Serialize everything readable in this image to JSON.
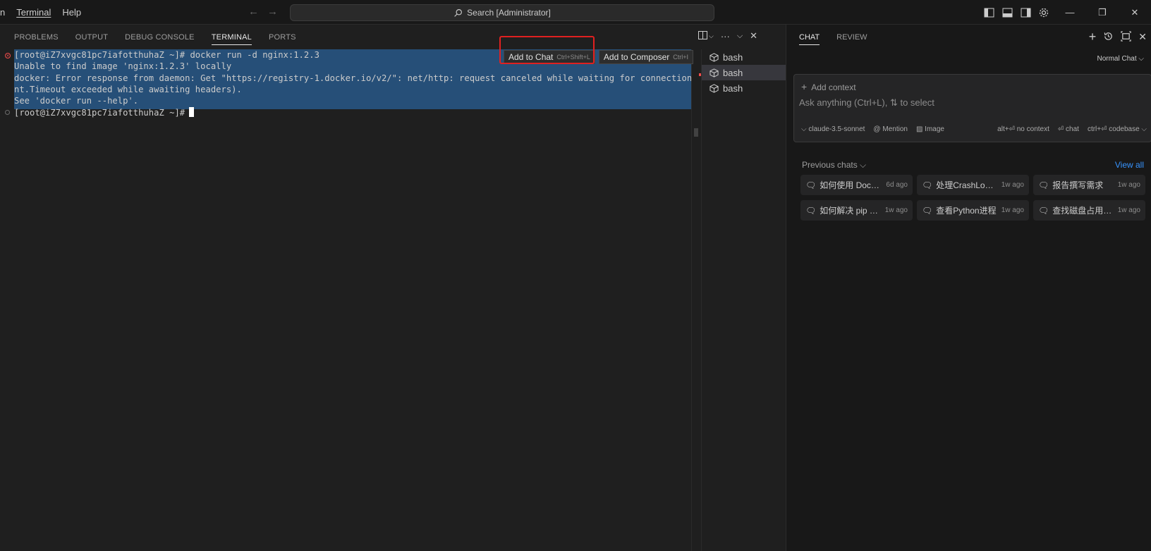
{
  "menu": {
    "items": [
      "n",
      "Terminal",
      "Help"
    ]
  },
  "search": {
    "placeholder": "Search [Administrator]"
  },
  "panel": {
    "tabs": [
      "PROBLEMS",
      "OUTPUT",
      "DEBUG CONSOLE",
      "TERMINAL",
      "PORTS"
    ],
    "active_tab": "TERMINAL"
  },
  "terminal": {
    "lines": [
      "[root@iZ7xvgc81pc7iafotthuhaZ ~]# docker run -d nginx:1.2.3",
      "Unable to find image 'nginx:1.2.3' locally",
      "docker: Error response from daemon: Get \"https://registry-1.docker.io/v2/\": net/http: request canceled while waiting for connection (Clie",
      "nt.Timeout exceeded while awaiting headers).",
      "See 'docker run --help'.",
      "[root@iZ7xvgc81pc7iafotthuhaZ ~]#"
    ],
    "hover_actions": {
      "add_to_chat": "Add to Chat",
      "add_to_chat_shortcut": "Ctrl+Shift+L",
      "add_to_composer": "Add to Composer",
      "add_to_composer_shortcut": "Ctrl+I"
    }
  },
  "terminal_list": {
    "items": [
      "bash",
      "bash",
      "bash"
    ],
    "active_index": 1
  },
  "chat": {
    "tabs": [
      "CHAT",
      "REVIEW"
    ],
    "mode": "Normal Chat",
    "add_context": "Add context",
    "placeholder": "Ask anything (Ctrl+L), ⇅ to select",
    "model": "claude-3.5-sonnet",
    "mention": "Mention",
    "image": "Image",
    "no_context": "alt+⏎ no context",
    "chat_shortcut": "⏎ chat",
    "codebase": "ctrl+⏎ codebase",
    "previous_chats": "Previous chats",
    "view_all": "View all",
    "history": [
      {
        "title": "如何使用 Docker",
        "age": "6d ago"
      },
      {
        "title": "处理CrashLoopBackOff",
        "age": "1w ago"
      },
      {
        "title": "报告撰写需求",
        "age": "1w ago"
      },
      {
        "title": "如何解决 pip 安装",
        "age": "1w ago"
      },
      {
        "title": "查看Python进程",
        "age": "1w ago"
      },
      {
        "title": "查找磁盘占用大文件",
        "age": "1w ago"
      }
    ]
  },
  "colors": {
    "accent": "#3794ff",
    "selection": "#264f78",
    "error": "#f14c4c",
    "highlight_box": "#e02020"
  }
}
